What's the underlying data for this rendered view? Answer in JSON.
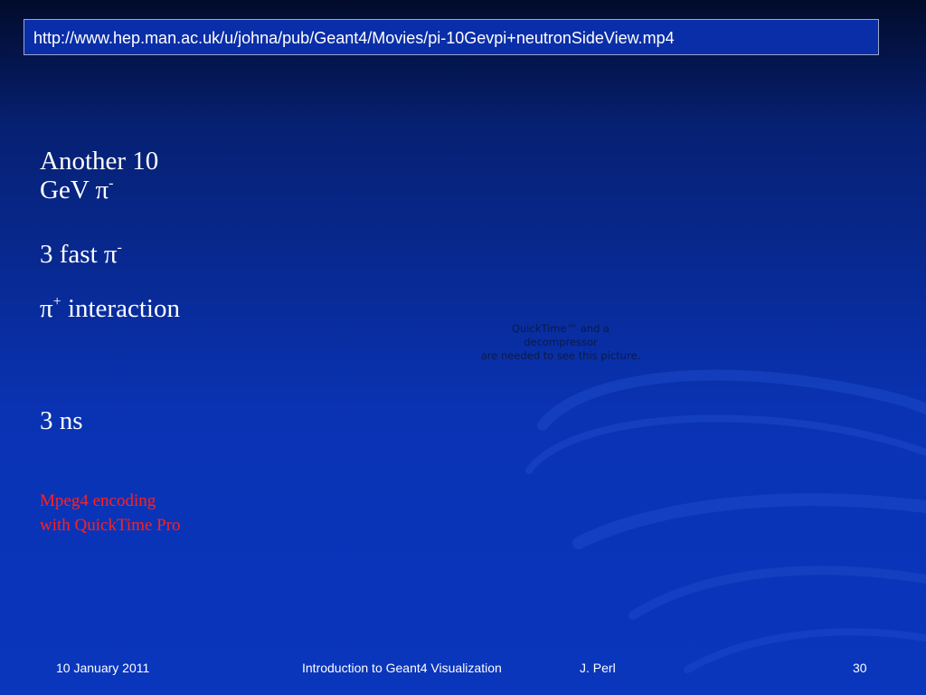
{
  "slide": {
    "url": "http://www.hep.man.ac.uk/u/johna/pub/Geant4/Movies/pi-10Gevpi+neutronSideView.mp4",
    "lines": {
      "line1a": "Another 10",
      "line1b_prefix": "GeV ",
      "pi_symbol": "π",
      "minus": "-",
      "plus": "+",
      "line2_prefix": "3 fast ",
      "line3_suffix": " interaction",
      "line4": "3 ns"
    },
    "note": {
      "line1": "Mpeg4 encoding",
      "line2": "with QuickTime Pro"
    },
    "quicktime_placeholder": {
      "line1": "QuickTime™ and a",
      "line2": "decompressor",
      "line3": "are needed to see this picture."
    }
  },
  "footer": {
    "date": "10 January 2011",
    "title": "Introduction to Geant4 Visualization",
    "author": "J. Perl",
    "page": "30"
  },
  "colors": {
    "background_top": "#020b2a",
    "background_main": "#0a36bd",
    "note_color": "#ff2020",
    "url_bar_border": "#9aa8c8"
  }
}
